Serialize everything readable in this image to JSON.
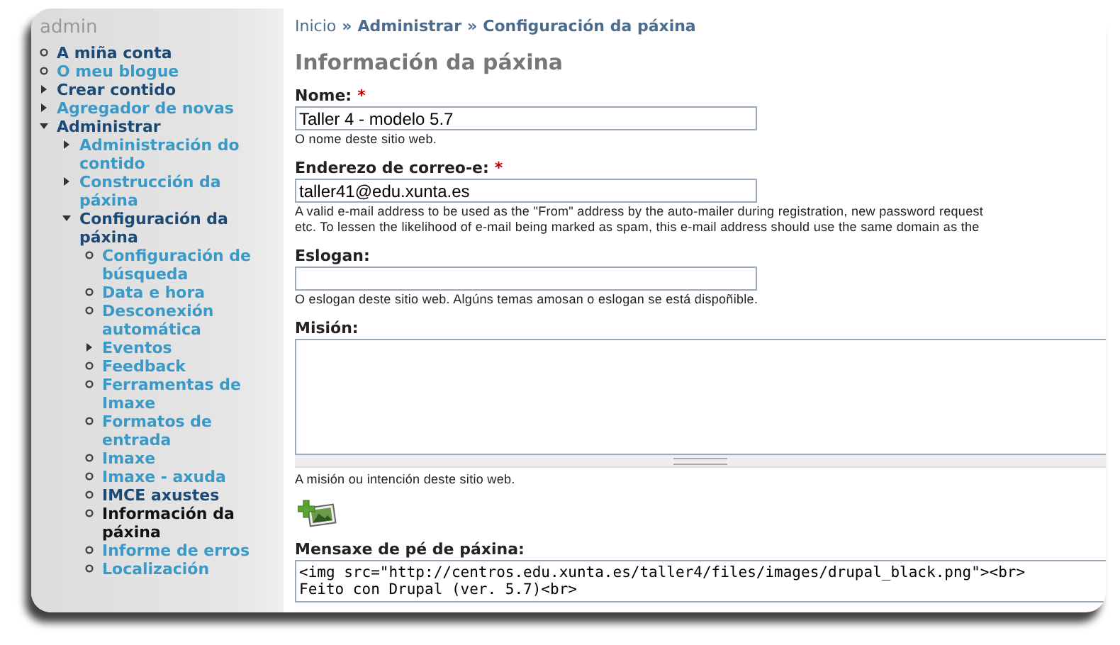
{
  "sidebar": {
    "title": "admin",
    "items": [
      {
        "label": "A miña conta",
        "kind": "leaf",
        "visited": true,
        "selected": false
      },
      {
        "label": "O meu blogue",
        "kind": "leaf",
        "visited": false,
        "selected": false
      },
      {
        "label": "Crear contido",
        "kind": "branch",
        "expanded": false,
        "visited": true,
        "selected": false
      },
      {
        "label": "Agregador de novas",
        "kind": "branch",
        "expanded": false,
        "visited": false,
        "selected": false
      },
      {
        "label": "Administrar",
        "kind": "branch",
        "expanded": true,
        "visited": true,
        "selected": false,
        "children": [
          {
            "label": "Administración do contido",
            "kind": "branch",
            "expanded": false,
            "visited": false,
            "selected": false
          },
          {
            "label": "Construcción da páxina",
            "kind": "branch",
            "expanded": false,
            "visited": false,
            "selected": false
          },
          {
            "label": "Configuración da páxina",
            "kind": "branch",
            "expanded": true,
            "visited": true,
            "selected": false,
            "children": [
              {
                "label": "Configuración de búsqueda",
                "kind": "leaf",
                "visited": false,
                "selected": false
              },
              {
                "label": "Data e hora",
                "kind": "leaf",
                "visited": false,
                "selected": false
              },
              {
                "label": "Desconexión automática",
                "kind": "leaf",
                "visited": false,
                "selected": false
              },
              {
                "label": "Eventos",
                "kind": "branch",
                "expanded": false,
                "visited": false,
                "selected": false
              },
              {
                "label": "Feedback",
                "kind": "leaf",
                "visited": false,
                "selected": false
              },
              {
                "label": "Ferramentas de Imaxe",
                "kind": "leaf",
                "visited": false,
                "selected": false
              },
              {
                "label": "Formatos de entrada",
                "kind": "leaf",
                "visited": false,
                "selected": false
              },
              {
                "label": "Imaxe",
                "kind": "leaf",
                "visited": false,
                "selected": false
              },
              {
                "label": "Imaxe - axuda",
                "kind": "leaf",
                "visited": false,
                "selected": false
              },
              {
                "label": "IMCE axustes",
                "kind": "leaf",
                "visited": true,
                "selected": false
              },
              {
                "label": "Información da páxina",
                "kind": "leaf",
                "visited": false,
                "selected": true
              },
              {
                "label": "Informe de erros",
                "kind": "leaf",
                "visited": false,
                "selected": false
              },
              {
                "label": "Localización",
                "kind": "leaf",
                "visited": false,
                "selected": false
              }
            ]
          }
        ]
      }
    ]
  },
  "breadcrumb": [
    "Inicio",
    "»",
    "Administrar",
    "»",
    "Configuración da páxina"
  ],
  "page_title": "Información da páxina",
  "fields": [
    {
      "kind": "text",
      "label": "Nome:",
      "required_mark": "*",
      "value": "Taller 4 - modelo 5.7",
      "description": [
        "O nome deste sitio web."
      ]
    },
    {
      "kind": "text",
      "label": "Enderezo de correo-e:",
      "required_mark": "*",
      "value": "taller41@edu.xunta.es",
      "description": [
        "A valid e-mail address to be used as the \"From\" address by the auto-mailer during registration, new password request",
        "etc. To lessen the likelihood of e-mail being marked as spam, this e-mail address should use the same domain as the"
      ]
    },
    {
      "kind": "text",
      "label": "Eslogan:",
      "description": [
        "O eslogan deste sitio web. Algúns temas amosan o eslogan se está dispoñible."
      ]
    },
    {
      "kind": "textarea",
      "label": "Misión:",
      "description": [
        "A misión ou intención deste sitio web."
      ]
    },
    {
      "kind": "image_button"
    },
    {
      "kind": "code",
      "label": "Mensaxe de pé de páxina:",
      "lines": [
        "<img src=\"http://centros.edu.xunta.es/taller4/files/images/drupal_black.png\"><br>",
        "Feito con Drupal (ver. 5.7)<br>"
      ]
    }
  ]
}
